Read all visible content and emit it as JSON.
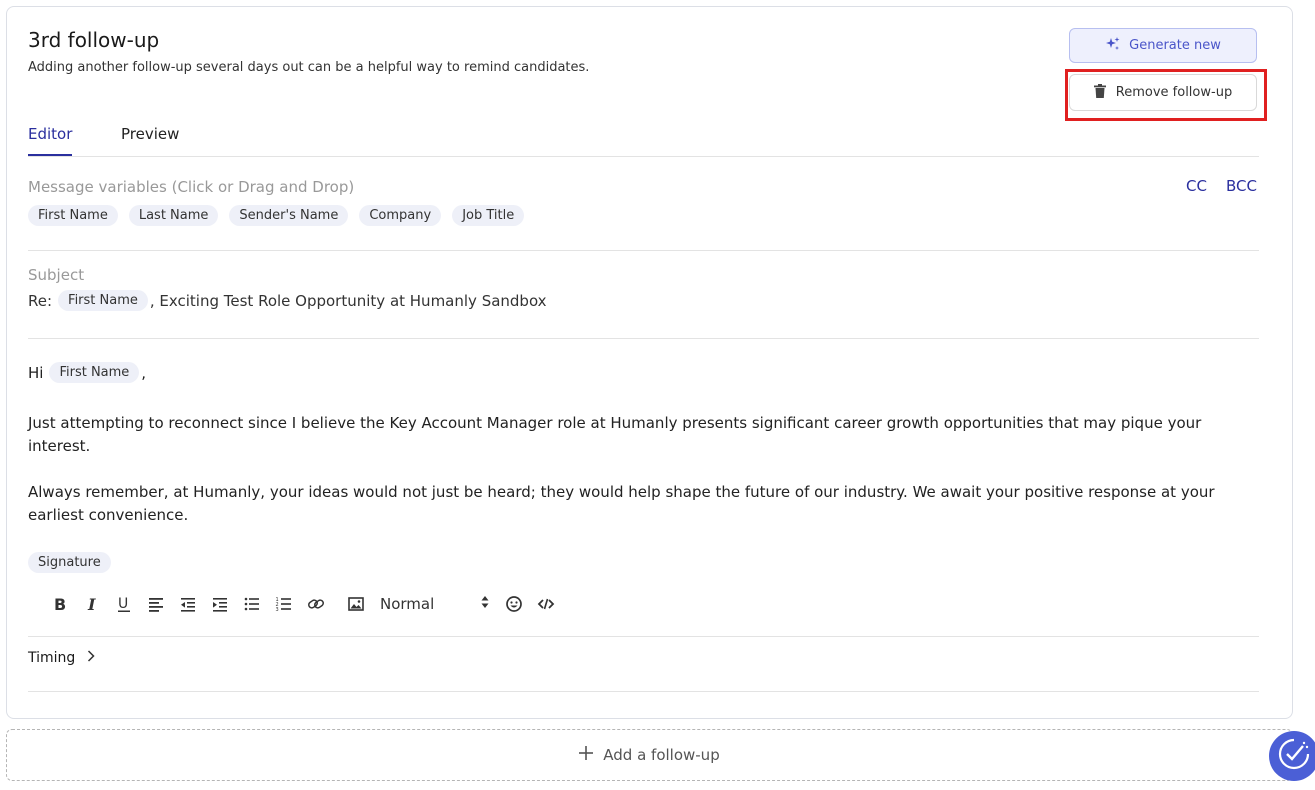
{
  "followup": {
    "title": "3rd follow-up",
    "subtitle": "Adding another follow-up several days out can be a helpful way to remind candidates.",
    "generate_label": "Generate new",
    "remove_label": "Remove follow-up"
  },
  "tabs": [
    {
      "label": "Editor",
      "active": true
    },
    {
      "label": "Preview",
      "active": false
    }
  ],
  "variables": {
    "label": "Message variables (Click or Drag and Drop)",
    "chips": [
      "First Name",
      "Last Name",
      "Sender's Name",
      "Company",
      "Job Title"
    ],
    "cc": "CC",
    "bcc": "BCC"
  },
  "subject": {
    "label": "Subject",
    "prefix": "Re:",
    "chip": "First Name",
    "suffix": ", Exciting Test Role Opportunity at Humanly Sandbox"
  },
  "body": {
    "greeting": "Hi",
    "greeting_chip": "First Name",
    "greeting_end": ",",
    "paragraph1": "Just attempting to reconnect since I believe the Key Account Manager role at Humanly presents significant career growth opportunities that may pique your interest.",
    "paragraph2": "Always remember, at Humanly, your ideas would not just be heard; they would help shape the future of our industry. We await your positive response at your earliest convenience.",
    "signature_chip": "Signature"
  },
  "toolbar": {
    "format_value": "Normal"
  },
  "timing_label": "Timing",
  "add_followup_label": "Add a follow-up",
  "colors": {
    "accent": "#2a2f9e",
    "highlight": "#e02020",
    "generate_bg": "#eef0fd"
  }
}
